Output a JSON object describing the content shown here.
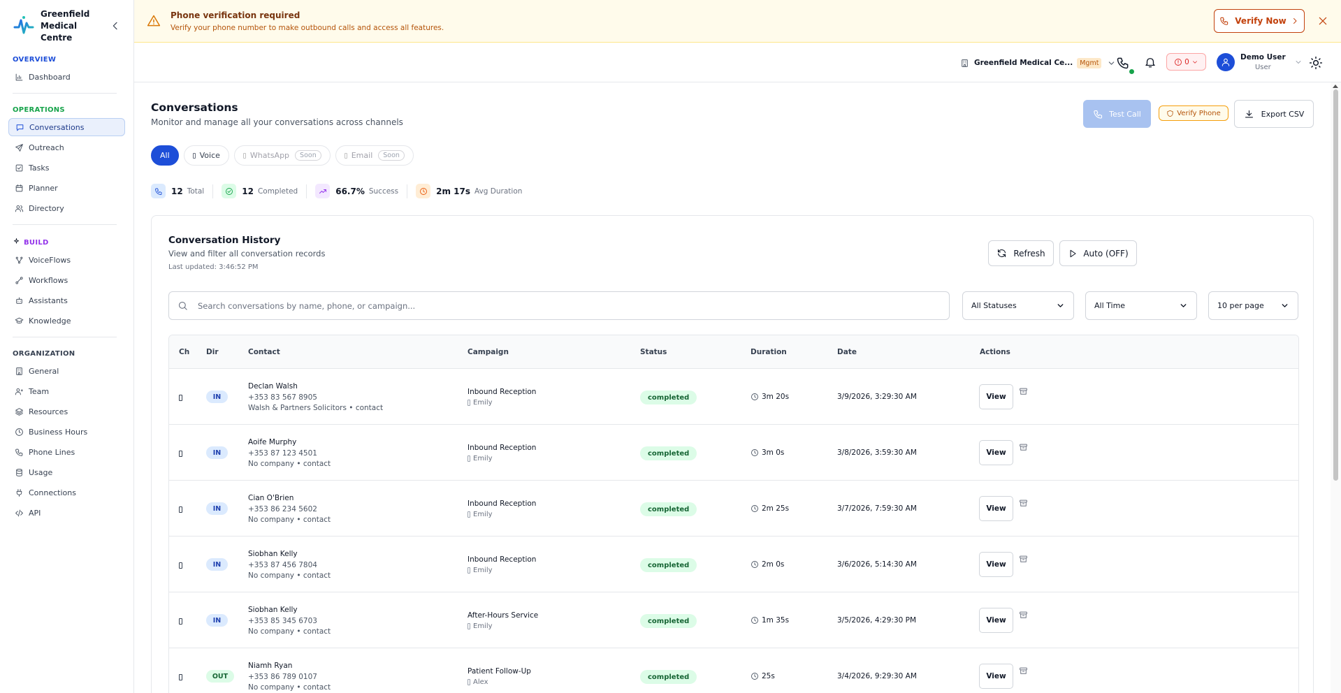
{
  "brand": {
    "name": "Greenfield Medical Centre"
  },
  "nav": {
    "sections": [
      {
        "title": "OVERVIEW",
        "color": "#1d4ed8",
        "items": [
          {
            "label": "Dashboard",
            "icon": "chart-icon"
          }
        ]
      },
      {
        "title": "OPERATIONS",
        "color": "#16a34a",
        "items": [
          {
            "label": "Conversations",
            "icon": "message-icon",
            "active": true
          },
          {
            "label": "Outreach",
            "icon": "send-icon"
          },
          {
            "label": "Tasks",
            "icon": "checkbox-icon"
          },
          {
            "label": "Planner",
            "icon": "calendar-icon"
          },
          {
            "label": "Directory",
            "icon": "users-icon"
          }
        ]
      },
      {
        "title": "BUILD",
        "color": "#9333ea",
        "items": [
          {
            "label": "VoiceFlows",
            "icon": "flow-icon"
          },
          {
            "label": "Workflows",
            "icon": "workflow-icon"
          },
          {
            "label": "Assistants",
            "icon": "bot-icon"
          },
          {
            "label": "Knowledge",
            "icon": "graduation-icon"
          }
        ]
      },
      {
        "title": "ORGANIZATION",
        "color": "#374151",
        "items": [
          {
            "label": "General",
            "icon": "building-icon"
          },
          {
            "label": "Team",
            "icon": "team-icon"
          },
          {
            "label": "Resources",
            "icon": "layers-icon"
          },
          {
            "label": "Business Hours",
            "icon": "clock-icon"
          },
          {
            "label": "Phone Lines",
            "icon": "phone-icon"
          },
          {
            "label": "Usage",
            "icon": "database-icon"
          },
          {
            "label": "Connections",
            "icon": "plug-icon"
          },
          {
            "label": "API",
            "icon": "code-icon"
          }
        ]
      }
    ]
  },
  "banner": {
    "title": "Phone verification required",
    "text": "Verify your phone number to make outbound calls and access all features.",
    "action": "Verify Now"
  },
  "topbar": {
    "org": "Greenfield Medical Ce...",
    "org_badge": "Mgmt",
    "alerts_count": "0",
    "user_name": "Demo User",
    "user_role": "User"
  },
  "page": {
    "title": "Conversations",
    "subtitle": "Monitor and manage all your conversations across channels",
    "test_call": "Test Call",
    "verify_phone": "Verify Phone",
    "export_csv": "Export CSV"
  },
  "channels": {
    "all": "All",
    "voice": "Voice",
    "whatsapp": "WhatsApp",
    "email": "Email",
    "soon": "Soon"
  },
  "stats": [
    {
      "value": "12",
      "label": "Total",
      "bg": "#dbeafe",
      "color": "#1d4ed8"
    },
    {
      "value": "12",
      "label": "Completed",
      "bg": "#dcfce7",
      "color": "#16a34a"
    },
    {
      "value": "66.7%",
      "label": "Success",
      "bg": "#f3e8ff",
      "color": "#9333ea"
    },
    {
      "value": "2m 17s",
      "label": "Avg Duration",
      "bg": "#ffedd5",
      "color": "#ea580c"
    }
  ],
  "history": {
    "title": "Conversation History",
    "subtitle": "View and filter all conversation records",
    "last_updated": "Last updated: 3:46:52 PM",
    "refresh": "Refresh",
    "auto": "Auto (OFF)",
    "search_placeholder": "Search conversations by name, phone, or campaign...",
    "status_filter": "All Statuses",
    "time_filter": "All Time",
    "per_page": "10 per page"
  },
  "table": {
    "columns": [
      "Ch",
      "Dir",
      "Contact",
      "Campaign",
      "Status",
      "Duration",
      "Date",
      "Actions"
    ],
    "view_label": "View",
    "rows": [
      {
        "dir": "IN",
        "name": "Declan Walsh",
        "phone": "+353 83 567 8905",
        "company": "Walsh & Partners Solicitors • contact",
        "campaign": "Inbound Reception",
        "assistant": "Emily",
        "status": "completed",
        "duration": "3m 20s",
        "date": "3/9/2026, 3:29:30 AM"
      },
      {
        "dir": "IN",
        "name": "Aoife Murphy",
        "phone": "+353 87 123 4501",
        "company": "No company • contact",
        "campaign": "Inbound Reception",
        "assistant": "Emily",
        "status": "completed",
        "duration": "3m 0s",
        "date": "3/8/2026, 3:59:30 AM"
      },
      {
        "dir": "IN",
        "name": "Cian O'Brien",
        "phone": "+353 86 234 5602",
        "company": "No company • contact",
        "campaign": "Inbound Reception",
        "assistant": "Emily",
        "status": "completed",
        "duration": "2m 25s",
        "date": "3/7/2026, 7:59:30 AM"
      },
      {
        "dir": "IN",
        "name": "Siobhan Kelly",
        "phone": "+353 87 456 7804",
        "company": "No company • contact",
        "campaign": "Inbound Reception",
        "assistant": "Emily",
        "status": "completed",
        "duration": "2m 0s",
        "date": "3/6/2026, 5:14:30 AM"
      },
      {
        "dir": "IN",
        "name": "Siobhan Kelly",
        "phone": "+353 85 345 6703",
        "company": "No company • contact",
        "campaign": "After-Hours Service",
        "assistant": "Emily",
        "status": "completed",
        "duration": "1m 35s",
        "date": "3/5/2026, 4:29:30 PM"
      },
      {
        "dir": "OUT",
        "name": "Niamh Ryan",
        "phone": "+353 86 789 0107",
        "company": "No company • contact",
        "campaign": "Patient Follow-Up",
        "assistant": "Alex",
        "status": "completed",
        "duration": "25s",
        "date": "3/4/2026, 9:29:30 AM"
      }
    ]
  }
}
